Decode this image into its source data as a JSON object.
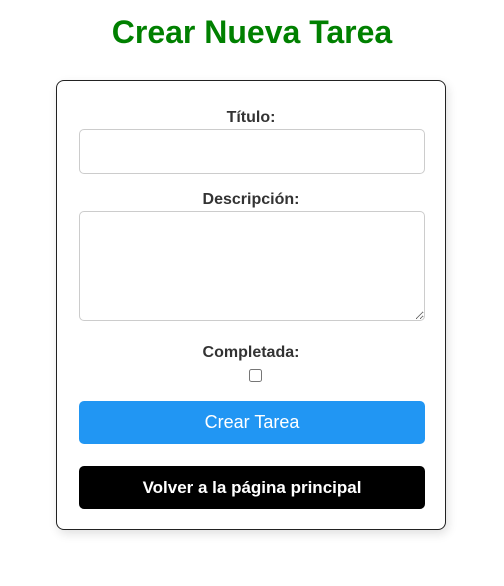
{
  "page": {
    "title": "Crear Nueva Tarea"
  },
  "form": {
    "title_label": "Título:",
    "title_value": "",
    "description_label": "Descripción:",
    "description_value": "",
    "completed_label": "Completada:",
    "completed_checked": false,
    "submit_label": "Crear Tarea",
    "back_label": "Volver a la página principal"
  },
  "colors": {
    "title": "#008000",
    "submit_bg": "#2196F3",
    "back_bg": "#000000"
  }
}
